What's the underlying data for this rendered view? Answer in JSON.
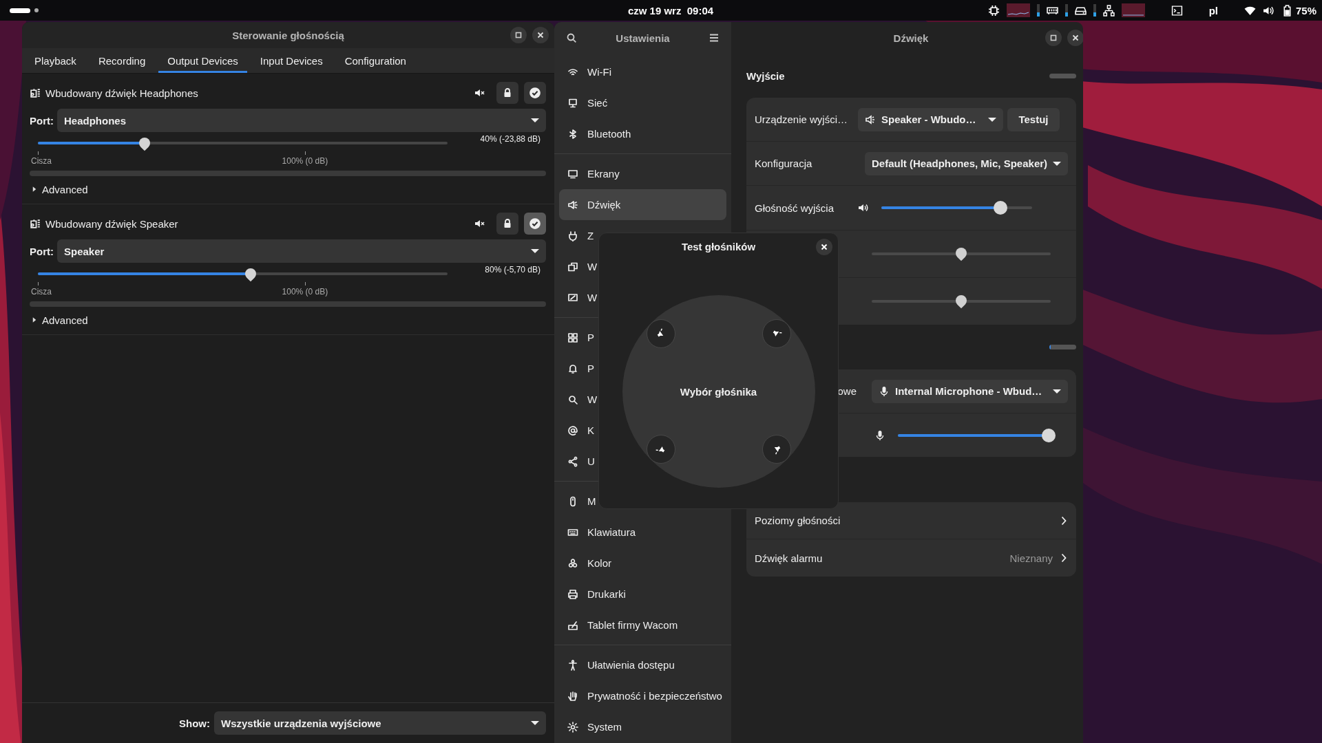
{
  "top_bar": {
    "clock": "czw 19 wrz  09:04",
    "keyboard_layout": "pl",
    "battery": "75%"
  },
  "mixer_window": {
    "title": "Sterowanie głośnością",
    "tabs": [
      {
        "label": "Playback",
        "selected": false
      },
      {
        "label": "Recording",
        "selected": false
      },
      {
        "label": "Output Devices",
        "selected": true
      },
      {
        "label": "Input Devices",
        "selected": false
      },
      {
        "label": "Configuration",
        "selected": false
      }
    ],
    "devices": [
      {
        "name": "Wbudowany dźwięk Headphones",
        "port_label": "Port:",
        "port": "Headphones",
        "default": false,
        "volume": {
          "level": 0.26,
          "reading": "40% (-23,88 dB)"
        },
        "scale_labels": [
          "Cisza",
          "100% (0 dB)"
        ],
        "meter": {
          "level": 0
        },
        "advanced": {
          "label": "Advanced",
          "expanded": false
        }
      },
      {
        "name": "Wbudowany dźwięk Speaker",
        "port_label": "Port:",
        "port": "Speaker",
        "default": true,
        "volume": {
          "level": 0.52,
          "reading": "80% (-5,70 dB)"
        },
        "scale_labels": [
          "Cisza",
          "100% (0 dB)"
        ],
        "meter": {
          "level": 0
        },
        "advanced": {
          "label": "Advanced",
          "expanded": false
        }
      }
    ],
    "show": {
      "label": "Show:",
      "value": "Wszystkie urządzenia wyjściowe"
    }
  },
  "settings_window": {
    "title": "Ustawienia",
    "groups": [
      {
        "items": [
          {
            "label": "Wi-Fi",
            "selected": false
          },
          {
            "label": "Sieć",
            "selected": false
          },
          {
            "label": "Bluetooth",
            "selected": false
          }
        ]
      },
      {
        "items": [
          {
            "label": "Ekrany",
            "selected": false
          },
          {
            "label": "Dźwięk",
            "selected": true
          },
          {
            "label": "Z",
            "selected": false
          },
          {
            "label": "W",
            "selected": false
          },
          {
            "label": "W",
            "selected": false
          }
        ]
      },
      {
        "items": [
          {
            "label": "P",
            "selected": false
          },
          {
            "label": "P",
            "selected": false
          },
          {
            "label": "W",
            "selected": false
          },
          {
            "label": "K",
            "selected": false
          },
          {
            "label": "U",
            "selected": false
          }
        ]
      },
      {
        "items": [
          {
            "label": "M",
            "selected": false
          },
          {
            "label": "Klawiatura",
            "selected": false
          },
          {
            "label": "Kolor",
            "selected": false
          },
          {
            "label": "Drukarki",
            "selected": false
          },
          {
            "label": "Tablet firmy Wacom",
            "selected": false
          }
        ]
      },
      {
        "items": [
          {
            "label": "Ułatwienia dostępu",
            "selected": false
          },
          {
            "label": "Prywatność i bezpieczeństwo",
            "selected": false
          },
          {
            "label": "System",
            "selected": false
          }
        ]
      }
    ]
  },
  "sound_page": {
    "title": "Dźwięk",
    "output": {
      "heading": "Wyjście",
      "meter": {
        "level": 0
      },
      "device": {
        "label": "Urządzenie wyjści…",
        "value": "Speaker - Wbudo…",
        "test_button": "Testuj"
      },
      "configuration": {
        "label": "Konfiguracja",
        "value": "Default (Headphones, Mic, Speaker)"
      },
      "volume": {
        "label": "Głośność wyjścia",
        "level": 0.79
      },
      "extra_sliders": [
        {
          "level": 0.5
        },
        {
          "level": 0.5
        }
      ]
    },
    "input": {
      "meter": {
        "level": 0.06
      },
      "device": {
        "label": "owe",
        "value": "Internal Microphone - Wbud…"
      },
      "volume": {
        "level": 1
      }
    },
    "links": [
      {
        "label": "Poziomy głośności"
      },
      {
        "label": "Dźwięk alarmu",
        "value": "Nieznany"
      }
    ]
  },
  "speaker_test": {
    "title": "Test głośników",
    "center_label": "Wybór głośnika"
  }
}
